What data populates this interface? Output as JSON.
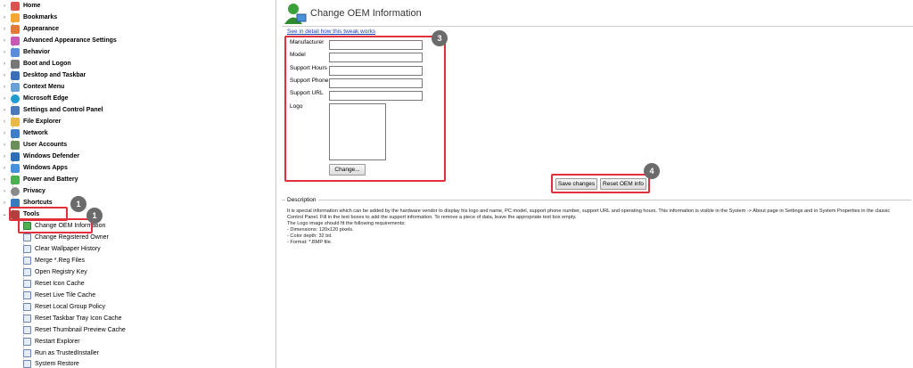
{
  "sidebar": {
    "categories": [
      {
        "label": "Home",
        "icon": "home-icon",
        "color": "#d9534f"
      },
      {
        "label": "Bookmarks",
        "icon": "star-icon",
        "color": "#f0a830"
      },
      {
        "label": "Appearance",
        "icon": "appearance-icon",
        "color": "#e07b39"
      },
      {
        "label": "Advanced Appearance Settings",
        "icon": "palette-icon",
        "color": "#c45ab3"
      },
      {
        "label": "Behavior",
        "icon": "behavior-icon",
        "color": "#5a8fd8"
      },
      {
        "label": "Boot and Logon",
        "icon": "boot-icon",
        "color": "#777777"
      },
      {
        "label": "Desktop and Taskbar",
        "icon": "desktop-icon",
        "color": "#3b6fb5"
      },
      {
        "label": "Context Menu",
        "icon": "context-menu-icon",
        "color": "#6aa0d8"
      },
      {
        "label": "Microsoft Edge",
        "icon": "edge-icon",
        "color": "#1f9bd1"
      },
      {
        "label": "Settings and Control Panel",
        "icon": "control-panel-icon",
        "color": "#4a7bb7"
      },
      {
        "label": "File Explorer",
        "icon": "folder-icon",
        "color": "#e8b84a"
      },
      {
        "label": "Network",
        "icon": "network-icon",
        "color": "#3d7fc4"
      },
      {
        "label": "User Accounts",
        "icon": "users-icon",
        "color": "#6b8e5a"
      },
      {
        "label": "Windows Defender",
        "icon": "shield-icon",
        "color": "#2f6db5"
      },
      {
        "label": "Windows Apps",
        "icon": "apps-icon",
        "color": "#4a90d9"
      },
      {
        "label": "Power and Battery",
        "icon": "battery-icon",
        "color": "#4caf50"
      },
      {
        "label": "Privacy",
        "icon": "privacy-icon",
        "color": "#8a8a8a"
      },
      {
        "label": "Shortcuts",
        "icon": "shortcut-icon",
        "color": "#3a78c2"
      },
      {
        "label": "Tools",
        "icon": "tools-icon",
        "color": "#b0413e"
      }
    ],
    "tools_items": [
      {
        "label": "Change OEM Information"
      },
      {
        "label": "Change Registered Owner"
      },
      {
        "label": "Clear Wallpaper History"
      },
      {
        "label": "Merge *.Reg Files"
      },
      {
        "label": "Open Registry Key"
      },
      {
        "label": "Reset Icon Cache"
      },
      {
        "label": "Reset Live Tile Cache"
      },
      {
        "label": "Reset Local Group Policy"
      },
      {
        "label": "Reset Taskbar Tray Icon Cache"
      },
      {
        "label": "Reset Thumbnail Preview Cache"
      },
      {
        "label": "Restart Explorer"
      },
      {
        "label": "Run as TrustedInstaller"
      },
      {
        "label": "System Restore"
      }
    ]
  },
  "badges": {
    "b1": "1",
    "b2": "1",
    "b3": "3",
    "b4": "4"
  },
  "main": {
    "title": "Change OEM Information",
    "detail_link": "See in detail how this tweak works",
    "form": {
      "manufacturer_label": "Manufacturer",
      "model_label": "Model",
      "support_hours_label": "Support Hours",
      "support_phone_label": "Support Phone",
      "support_url_label": "Support URL",
      "logo_label": "Logo",
      "change_button": "Change..."
    },
    "save_button": "Save changes",
    "reset_button": "Reset OEM info",
    "description": {
      "title": "Description",
      "lines": [
        "It is special information which can be added by the hardware vendor to display his logo and name, PC model, support phone number, support URL and operating hours. This information is visible in the System -> About page in Settings and in System Properties in the classic",
        "Control Panel. Fill in the text boxes to add the support information. To remove a piece of data, leave the appropriate text box empty.",
        "The Logo image should fit the following requirements:",
        "- Dimensions: 120x120 pixels.",
        "- Color depth: 32 bit.",
        "- Format: *.BMP file."
      ]
    }
  },
  "colors": {
    "highlight": "#e2303a",
    "badge": "#6b6b6b",
    "link": "#1a3cbf"
  }
}
